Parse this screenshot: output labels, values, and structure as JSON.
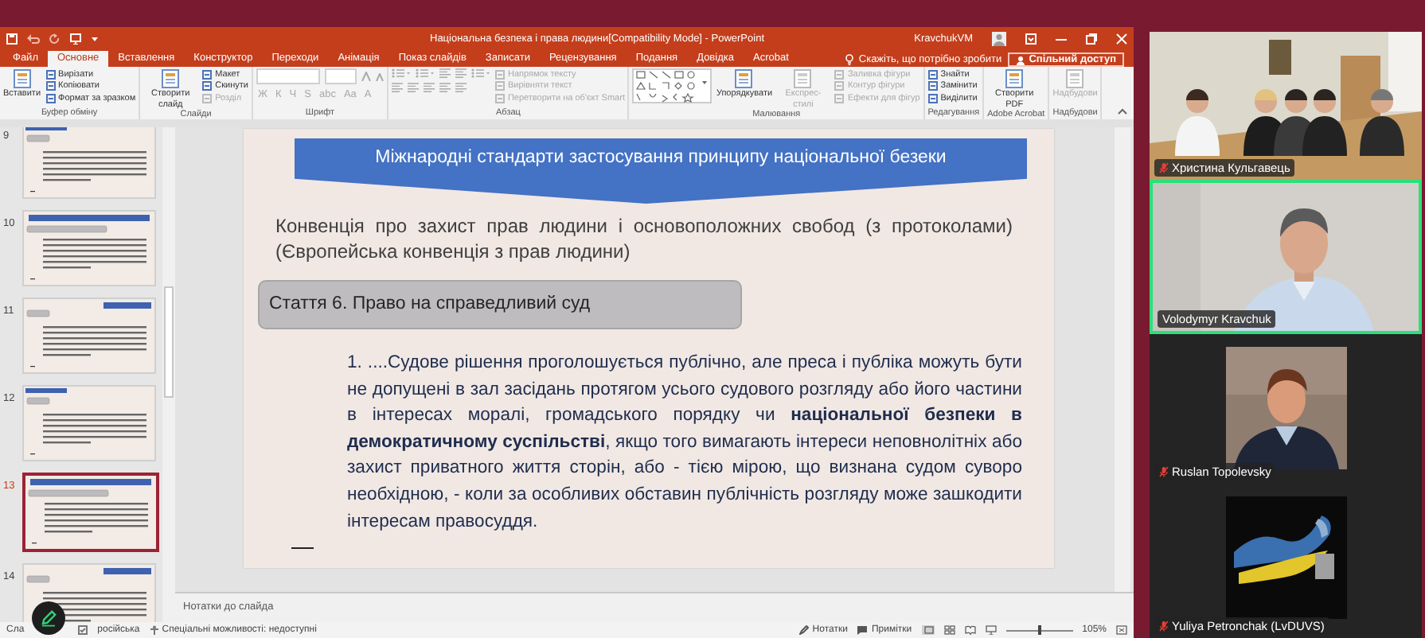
{
  "window": {
    "title": "Національна безпека і права людини[Compatibility Mode] - PowerPoint",
    "user": "KravchukVM"
  },
  "ribbon_tabs": [
    {
      "label": "Файл",
      "selected": false
    },
    {
      "label": "Основне",
      "selected": true
    },
    {
      "label": "Вставлення",
      "selected": false
    },
    {
      "label": "Конструктор",
      "selected": false
    },
    {
      "label": "Переходи",
      "selected": false
    },
    {
      "label": "Анімація",
      "selected": false
    },
    {
      "label": "Показ слайдів",
      "selected": false
    },
    {
      "label": "Записати",
      "selected": false
    },
    {
      "label": "Рецензування",
      "selected": false
    },
    {
      "label": "Подання",
      "selected": false
    },
    {
      "label": "Довідка",
      "selected": false
    },
    {
      "label": "Acrobat",
      "selected": false
    }
  ],
  "tell_me": "Скажіть, що потрібно зробити",
  "share_button": "Спільний доступ",
  "ribbon_groups": [
    {
      "label": "Буфер обміну",
      "kind": "buttons",
      "items": [
        {
          "label": "Вставити",
          "kind": "large",
          "disabled": false
        },
        {
          "label": "Вирізати",
          "kind": "small",
          "disabled": false
        },
        {
          "label": "Копіювати",
          "kind": "small",
          "disabled": false
        },
        {
          "label": "Формат за зразком",
          "kind": "small",
          "disabled": false
        }
      ]
    },
    {
      "label": "Слайди",
      "kind": "buttons",
      "items": [
        {
          "label": "Створити слайд",
          "kind": "large",
          "disabled": false
        },
        {
          "label": "Макет",
          "kind": "small",
          "disabled": false
        },
        {
          "label": "Скинути",
          "kind": "small",
          "disabled": false
        },
        {
          "label": "Розділ",
          "kind": "small",
          "disabled": true
        }
      ]
    },
    {
      "label": "Шрифт",
      "kind": "font",
      "items": [
        {
          "label": "Ж",
          "kind": "glyph",
          "disabled": true
        },
        {
          "label": "К",
          "kind": "glyph",
          "disabled": true
        },
        {
          "label": "Ч",
          "kind": "glyph",
          "disabled": true
        },
        {
          "label": "S",
          "kind": "glyph",
          "disabled": true
        },
        {
          "label": "abc",
          "kind": "glyph",
          "disabled": true
        },
        {
          "label": "Aa",
          "kind": "glyph",
          "disabled": true
        },
        {
          "label": "A",
          "kind": "glyph",
          "disabled": true
        }
      ]
    },
    {
      "label": "Абзац",
      "kind": "paragraph",
      "items": [
        {
          "label": "Напрямок тексту",
          "kind": "small",
          "disabled": true
        },
        {
          "label": "Вирівняти текст",
          "kind": "small",
          "disabled": true
        },
        {
          "label": "Перетворити на об'єкт Smart",
          "kind": "small",
          "disabled": true
        }
      ]
    },
    {
      "label": "Малювання",
      "kind": "drawing",
      "items": [
        {
          "label": "Упорядкувати",
          "kind": "large",
          "disabled": false
        },
        {
          "label": "Експрес-стилі",
          "kind": "large",
          "disabled": true
        },
        {
          "label": "Заливка фігури",
          "kind": "small",
          "disabled": true
        },
        {
          "label": "Контур фігури",
          "kind": "small",
          "disabled": true
        },
        {
          "label": "Ефекти для фігур",
          "kind": "small",
          "disabled": true
        }
      ]
    },
    {
      "label": "Редагування",
      "kind": "buttons",
      "items": [
        {
          "label": "Знайти",
          "kind": "small",
          "disabled": false
        },
        {
          "label": "Замінити",
          "kind": "small",
          "disabled": false
        },
        {
          "label": "Виділити",
          "kind": "small",
          "disabled": false
        }
      ]
    },
    {
      "label": "Adobe Acrobat",
      "kind": "buttons",
      "items": [
        {
          "label": "Створити PDF",
          "kind": "large",
          "disabled": false
        }
      ]
    },
    {
      "label": "Надбудови",
      "kind": "buttons",
      "items": [
        {
          "label": "Надбудови",
          "kind": "large",
          "disabled": true
        }
      ]
    }
  ],
  "thumbnails": [
    {
      "number": "9",
      "selected": false
    },
    {
      "number": "10",
      "selected": false
    },
    {
      "number": "11",
      "selected": false
    },
    {
      "number": "12",
      "selected": false
    },
    {
      "number": "13",
      "selected": true
    },
    {
      "number": "14",
      "selected": false
    }
  ],
  "slide": {
    "title": "Міжнародні стандарти застосування принципу національної безеки",
    "convention": "Конвенція про захист прав людини і основоположних свобод (з протоколами) (Європейська конвенція з прав людини)",
    "article": "Стаття 6. Право на справедливий суд",
    "paragraph": "1. ....Судове рішення проголошується публічно, але преса і публіка можуть бути не допущені в зал засідань протягом усього судового розгляду або його частини в інтересах моралі, громадського порядку чи **національної безпеки в демократичному суспільстві**, якщо того вимагають інтереси неповнолітніх або захист приватного життя сторін, або - тією мірою, що визнана судом суворо необхідною, - коли за особливих обставин публічність розгляду може зашкодити інтересам правосуддя."
  },
  "notes_placeholder": "Нотатки до слайда",
  "status_bar": {
    "slide_info": "Сла",
    "language": "російська",
    "accessibility": "Спеціальні можливості: недоступні",
    "notes": "Нотатки",
    "comments": "Примітки",
    "zoom": "105%",
    "zoom_slider": {
      "level": 0.52
    }
  },
  "participants": [
    {
      "name": "Христина Кульгавець",
      "kind": "video",
      "muted": true,
      "speaking": false
    },
    {
      "name": "Volodymyr Kravchuk",
      "kind": "video",
      "muted": false,
      "speaking": true
    },
    {
      "name": "Ruslan Topolevsky",
      "muted": true,
      "speaking": false
    },
    {
      "name": "Yuliya Petronchak (LvDUVS)",
      "muted": true,
      "speaking": false
    }
  ]
}
